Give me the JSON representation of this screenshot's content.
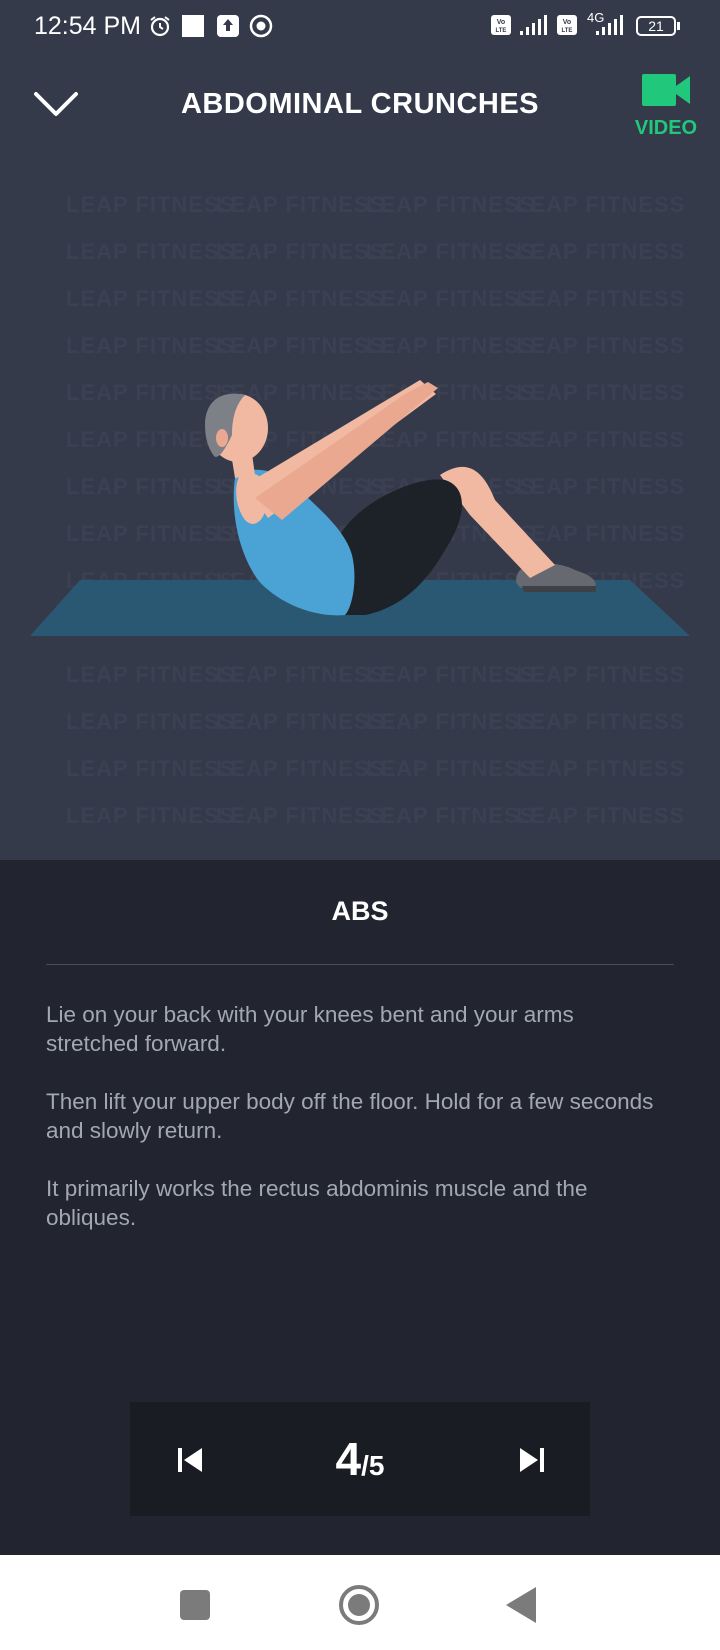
{
  "status_bar": {
    "time": "12:54 PM",
    "network_type": "4G",
    "battery": "21",
    "icons": [
      "alarm-icon",
      "square-notification-icon",
      "upload-icon",
      "whatsapp-icon",
      "volte-icon",
      "signal-icon",
      "battery-icon"
    ]
  },
  "header": {
    "title": "ABDOMINAL CRUNCHES",
    "video_label": "VIDEO",
    "accent_color": "#21c77a"
  },
  "watermark": {
    "text": "LEAP FITNESS"
  },
  "body": {
    "category": "ABS",
    "description": [
      "Lie on your back with your knees bent and your arms stretched forward.",
      "Then lift your upper body off the floor. Hold for a few seconds and slowly return.",
      "It primarily works the rectus abdominis muscle and the obliques."
    ]
  },
  "navigation": {
    "current": "4",
    "total": "/5"
  },
  "system_nav": [
    "recents-icon",
    "home-icon",
    "back-icon"
  ]
}
